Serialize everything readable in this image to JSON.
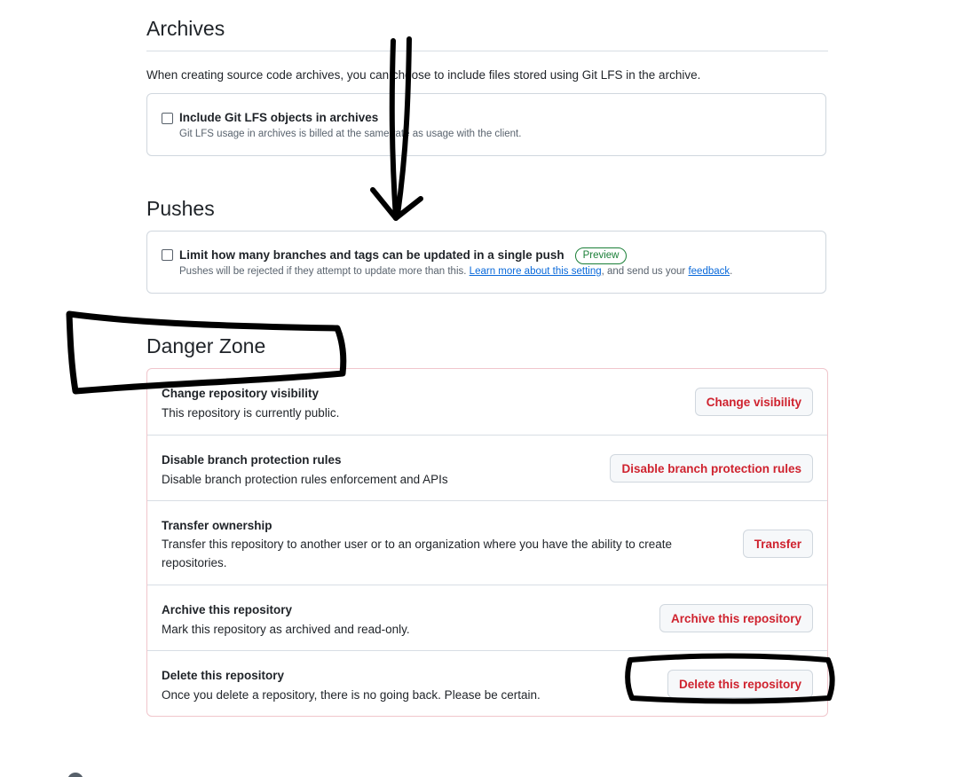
{
  "archives": {
    "title": "Archives",
    "description": "When creating source code archives, you can choose to include files stored using Git LFS in the archive.",
    "option_label": "Include Git LFS objects in archives",
    "option_hint": "Git LFS usage in archives is billed at the same rate as usage with the client."
  },
  "pushes": {
    "title": "Pushes",
    "option_label": "Limit how many branches and tags can be updated in a single push",
    "badge": "Preview",
    "hint_prefix": "Pushes will be rejected if they attempt to update more than this.",
    "learn_more_link": "Learn more about this setting",
    "hint_middle": ", and send us your",
    "feedback_link": "feedback",
    "hint_suffix": "."
  },
  "danger_zone": {
    "title": "Danger Zone",
    "rows": [
      {
        "title": "Change repository visibility",
        "description": "This repository is currently public.",
        "button": "Change visibility"
      },
      {
        "title": "Disable branch protection rules",
        "description": "Disable branch protection rules enforcement and APIs",
        "button": "Disable branch protection rules"
      },
      {
        "title": "Transfer ownership",
        "description": "Transfer this repository to another user or to an organization where you have the ability to create repositories.",
        "button": "Transfer"
      },
      {
        "title": "Archive this repository",
        "description": "Mark this repository as archived and read-only.",
        "button": "Archive this repository"
      },
      {
        "title": "Delete this repository",
        "description": "Once you delete a repository, there is no going back. Please be certain.",
        "button": "Delete this repository"
      }
    ]
  },
  "colors": {
    "danger": "#cf222e",
    "link": "#0969da",
    "preview_badge": "#1a7f37",
    "annotation_ink": "#000000"
  },
  "annotations": [
    "down-arrow-annotation",
    "danger-zone-highlight",
    "delete-button-highlight"
  ]
}
